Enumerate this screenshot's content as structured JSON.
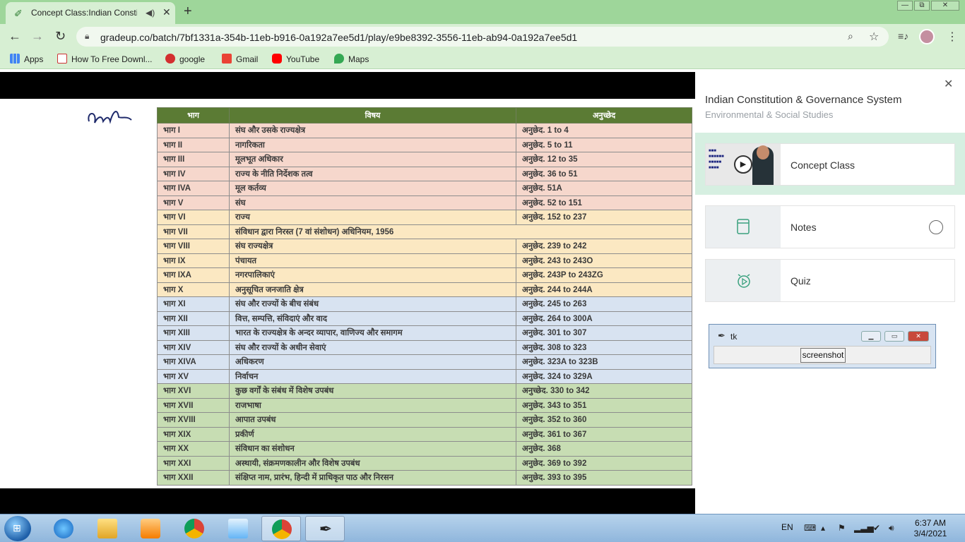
{
  "browser": {
    "tab_title": "Concept Class:Indian Constit",
    "new_tab": "+",
    "url": "gradeup.co/batch/7bf1331a-354b-11eb-b916-0a192a7ee5d1/play/e9be8392-3556-11eb-ab94-0a192a7ee5d1",
    "window_controls": {
      "minimize": "—",
      "restore": "⧉",
      "close": "✕"
    },
    "bookmarks": [
      {
        "label": "Apps",
        "color": "#4285f4"
      },
      {
        "label": "How To Free Downl...",
        "color": "#ffffff"
      },
      {
        "label": "google",
        "color": "#d32f2f"
      },
      {
        "label": "Gmail",
        "color": "#ea4335"
      },
      {
        "label": "YouTube",
        "color": "#ff0000"
      },
      {
        "label": "Maps",
        "color": "#34a853"
      }
    ]
  },
  "table": {
    "headers": [
      "भाग",
      "विषय",
      "अनुच्छेद"
    ],
    "rows": [
      {
        "part": "भाग I",
        "subject": "संघ और उसके राज्यक्षेत्र",
        "articles": "अनुछेद. 1 to 4",
        "color": "pink"
      },
      {
        "part": "भाग II",
        "subject": "नागरिकता",
        "articles": "अनुछेद. 5 to 11",
        "color": "pink"
      },
      {
        "part": "भाग III",
        "subject": "मूलभूत अधिकार",
        "articles": "अनुछेद. 12 to 35",
        "color": "pink"
      },
      {
        "part": "भाग IV",
        "subject": "राज्य के नीति निर्देशक तत्व",
        "articles": "अनुछेद. 36 to 51",
        "color": "pink"
      },
      {
        "part": "भाग IVA",
        "subject": "मूल कर्तव्य",
        "articles": "अनुछेद. 51A",
        "color": "pink"
      },
      {
        "part": "भाग V",
        "subject": "संघ",
        "articles": "अनुछेद. 52 to 151",
        "color": "pink"
      },
      {
        "part": "भाग VI",
        "subject": "राज्य",
        "articles": "अनुछेद. 152 to 237",
        "color": "yel"
      },
      {
        "part": "भाग VII",
        "subject": "संविधान द्वारा निरस्त (7 वां संशोधन) अधिनियम, 1956",
        "articles": "",
        "color": "yel",
        "span": true
      },
      {
        "part": "भाग VIII",
        "subject": "संघ राज्यक्षेत्र",
        "articles": "अनुछेद. 239 to 242",
        "color": "yel"
      },
      {
        "part": "भाग IX",
        "subject": "पंचायत",
        "articles": "अनुछेद. 243 to 243O",
        "color": "yel"
      },
      {
        "part": "भाग IXA",
        "subject": "नगरपालिकाएं",
        "articles": "अनुछेद. 243P to 243ZG",
        "color": "yel"
      },
      {
        "part": "भाग X",
        "subject": "अनुसूचित जनजाति क्षेत्र",
        "articles": "अनुछेद. 244 to 244A",
        "color": "yel"
      },
      {
        "part": "भाग XI",
        "subject": "संघ और राज्यों के बीच संबंध",
        "articles": "अनुछेद. 245 to 263",
        "color": "blue"
      },
      {
        "part": "भाग XII",
        "subject": "वित्त, सम्पत्ति, संविदाएं और वाद",
        "articles": "अनुछेद. 264 to 300A",
        "color": "blue"
      },
      {
        "part": "भाग XIII",
        "subject": "भारत के राज्यक्षेत्र के अन्दर व्यापार, वाणिज्य और समागम",
        "articles": "अनुछेद. 301 to 307",
        "color": "blue"
      },
      {
        "part": "भाग XIV",
        "subject": "संघ और राज्यों के अधीन सेवाएं",
        "articles": "अनुछेद. 308 to 323",
        "color": "blue"
      },
      {
        "part": "भाग XIVA",
        "subject": "अधिकरण",
        "articles": "अनुछेद. 323A to 323B",
        "color": "blue"
      },
      {
        "part": "भाग XV",
        "subject": "निर्वाचन",
        "articles": "अनुछेद. 324 to 329A",
        "color": "blue"
      },
      {
        "part": "भाग XVI",
        "subject": "कुछ वर्गों के संबंध में विशेष उपबंध",
        "articles": "अनुच्छेद. 330 to 342",
        "color": "grn"
      },
      {
        "part": "भाग XVII",
        "subject": "राजभाषा",
        "articles": "अनुछेद. 343 to 351",
        "color": "grn"
      },
      {
        "part": "भाग XVIII",
        "subject": "आपात उपबंध",
        "articles": "अनुछेद. 352 to 360",
        "color": "grn"
      },
      {
        "part": "भाग XIX",
        "subject": "प्रकीर्ण",
        "articles": "अनुछेद. 361 to 367",
        "color": "grn"
      },
      {
        "part": "भाग XX",
        "subject": "संविधान का संशोधन",
        "articles": "अनुछेद. 368",
        "color": "grn"
      },
      {
        "part": "भाग XXI",
        "subject": "अस्थायी, संक्रमणकालीन और विशेष उपबंध",
        "articles": "अनुछेद. 369 to 392",
        "color": "grn"
      },
      {
        "part": "भाग XXII",
        "subject": "संक्षिप्त नाम, प्रारंभ, हिन्दी में प्राधिकृत पाठ और निरसन",
        "articles": "अनुछेद. 393 to 395",
        "color": "grn"
      }
    ]
  },
  "sidebar": {
    "close": "✕",
    "title": "Indian Constitution & Governance System",
    "subtitle": "Environmental & Social Studies",
    "items": [
      {
        "label": "Concept Class"
      },
      {
        "label": "Notes"
      },
      {
        "label": "Quiz"
      }
    ]
  },
  "tk_window": {
    "title": "tk",
    "button": "screenshot"
  },
  "taskbar": {
    "lang": "EN",
    "time": "6:37 AM",
    "date": "3/4/2021"
  }
}
